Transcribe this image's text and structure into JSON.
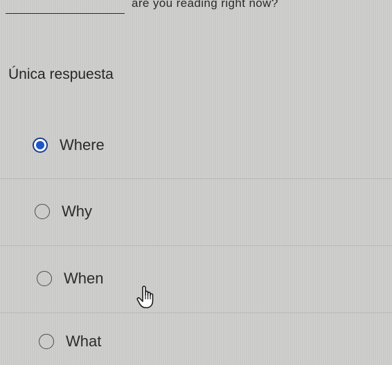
{
  "question": {
    "text": "are you reading right now?"
  },
  "question_type": "Única respuesta",
  "options": [
    {
      "label": "Where",
      "selected": true
    },
    {
      "label": "Why",
      "selected": false
    },
    {
      "label": "When",
      "selected": false
    },
    {
      "label": "What",
      "selected": false
    }
  ],
  "colors": {
    "selected_radio": "#1c56c7",
    "background": "#cfd0cd"
  },
  "cursor": {
    "icon": "hand-pointer-icon"
  }
}
